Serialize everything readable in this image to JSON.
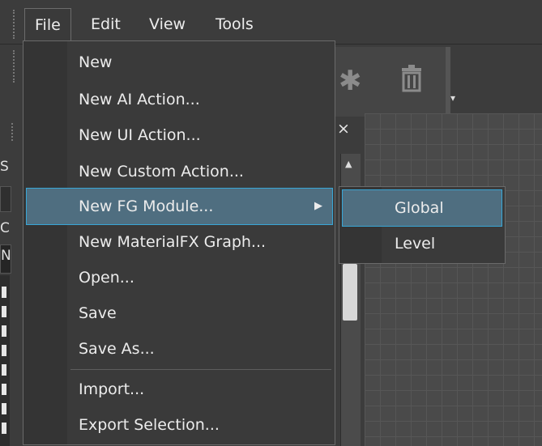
{
  "menubar": {
    "items": [
      "File",
      "Edit",
      "View",
      "Tools"
    ],
    "active": "File"
  },
  "toolbar": {
    "icons": [
      "bug-icon",
      "trash-icon"
    ],
    "overflow_glyph": "▾"
  },
  "left_panel": {
    "letters": [
      "S",
      "C",
      "N"
    ]
  },
  "panel": {
    "close_glyph": "×",
    "scroll_up_glyph": "▲"
  },
  "file_menu": {
    "items": [
      {
        "label": "New"
      },
      {
        "label": "New AI Action..."
      },
      {
        "label": "New UI Action..."
      },
      {
        "label": "New Custom Action..."
      },
      {
        "label": "New FG Module...",
        "has_submenu": true,
        "highlighted": true
      },
      {
        "label": "New MaterialFX Graph..."
      },
      {
        "label": "Open..."
      },
      {
        "label": "Save"
      },
      {
        "label": "Save As..."
      },
      {
        "label": "Import..."
      },
      {
        "label": "Export Selection..."
      }
    ],
    "submenu_arrow": "▶"
  },
  "fg_module_submenu": {
    "items": [
      {
        "label": "Global",
        "highlighted": true
      },
      {
        "label": "Level"
      }
    ]
  },
  "colors": {
    "highlight_bg": "#4f6e80",
    "highlight_border": "#38a6d6",
    "menu_bg": "#3a3a3a",
    "window_bg": "#3c3c3c"
  }
}
